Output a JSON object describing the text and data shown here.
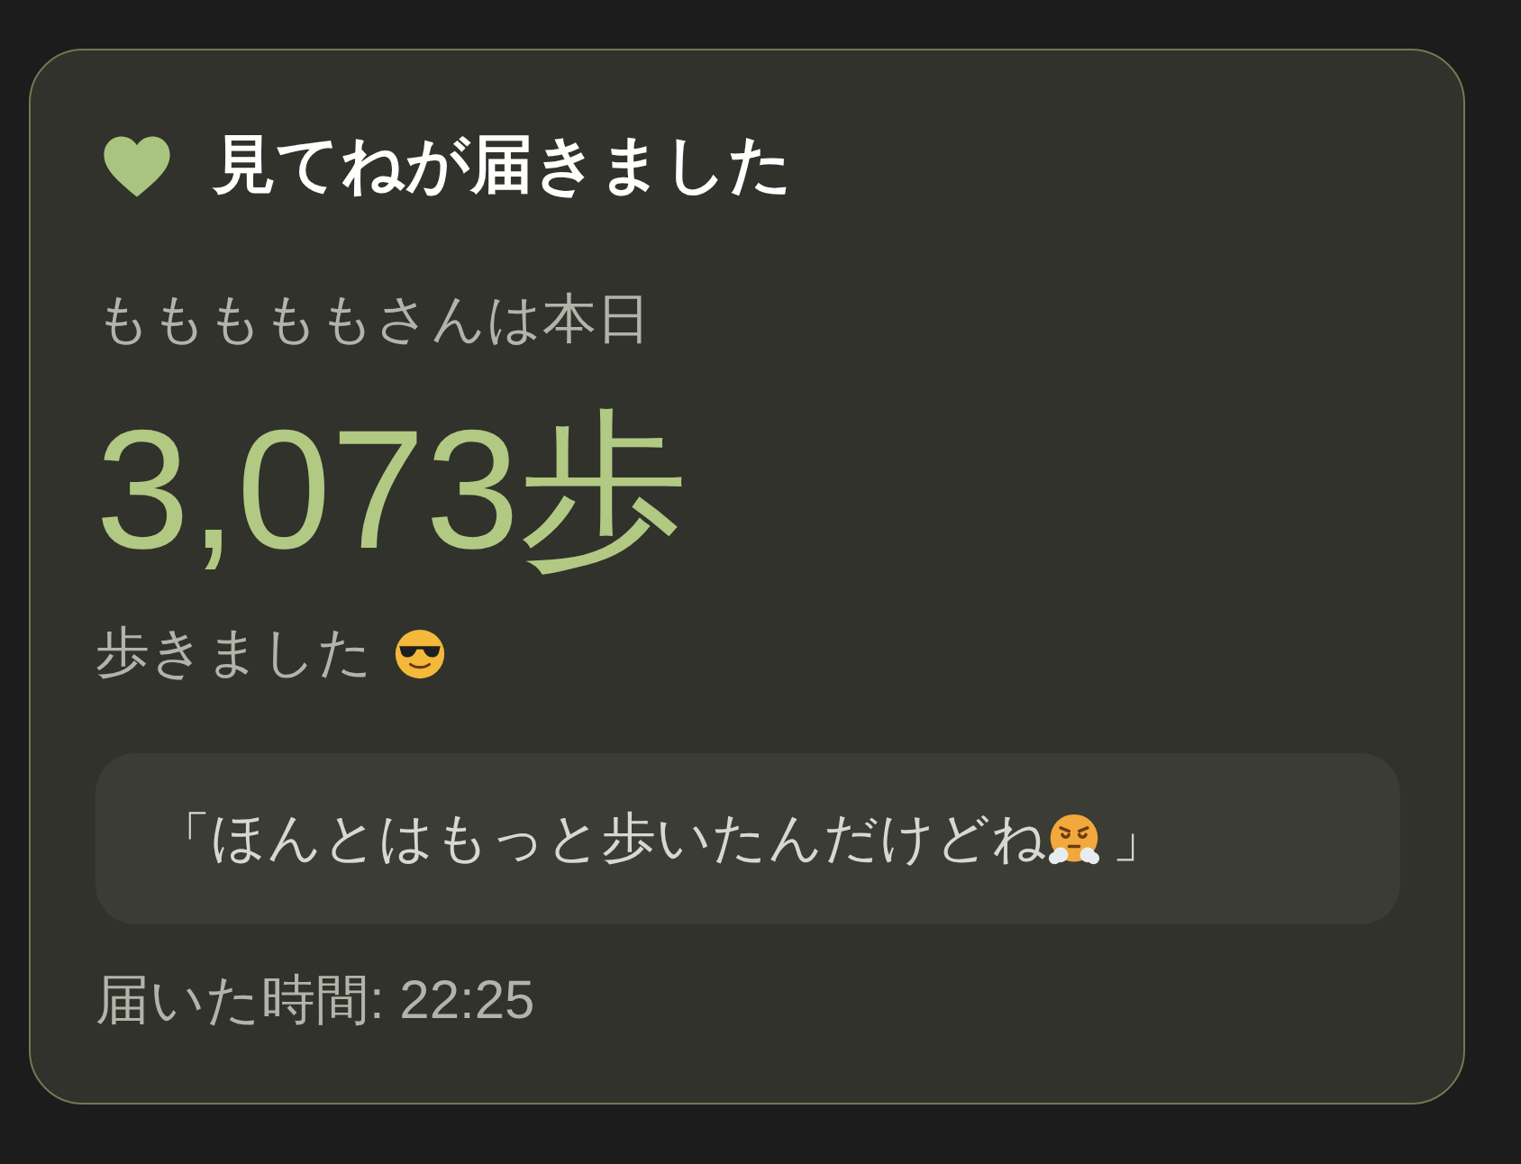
{
  "card": {
    "title": "見てねが届きました",
    "subtitle": "もももももさんは本日",
    "steps": "3,073歩",
    "walked": "歩きました",
    "quote": {
      "text": "「ほんとはもっと歩いたんだけどね",
      "closing": "」"
    },
    "received": "届いた時間: 22:25"
  }
}
